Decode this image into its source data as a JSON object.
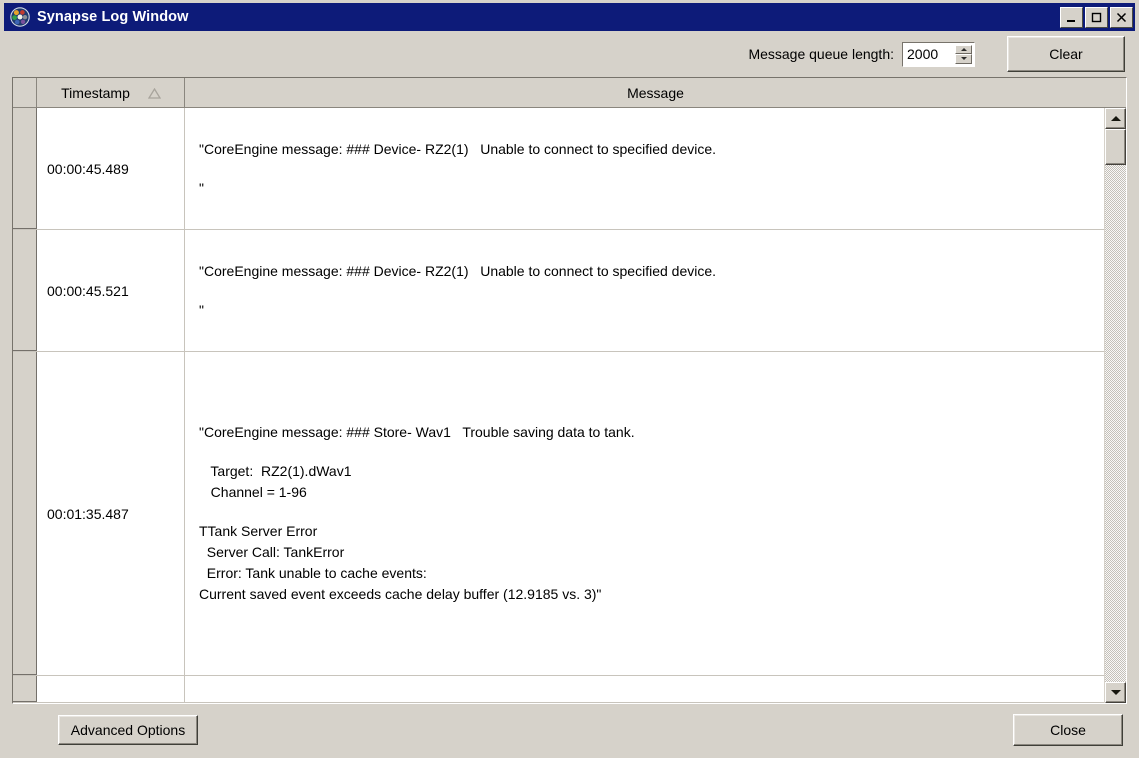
{
  "window": {
    "title": "Synapse Log Window",
    "icon": "synapse-logo-icon",
    "minimize_label": "Minimize",
    "maximize_label": "Maximize",
    "close_label": "Close"
  },
  "colors": {
    "titlebar": "#0d1b79",
    "chrome": "#d6d2ca",
    "grid_background": "#ffffff",
    "grid_line": "#c8c4bc",
    "text": "#000000"
  },
  "toolbar": {
    "queue_label": "Message queue length:",
    "queue_value": "2000",
    "queue_placeholder": "2000",
    "clear_label": "Clear"
  },
  "grid": {
    "columns": [
      {
        "key": "timestamp",
        "label": "Timestamp",
        "sort": "ascending",
        "sort_icon": "sort-ascending-triangle-icon"
      },
      {
        "key": "message",
        "label": "Message",
        "sort": "none"
      }
    ],
    "rows": [
      {
        "timestamp": "00:00:45.489",
        "lines": [
          "\"CoreEngine message: ### Device- RZ2(1)   Unable to connect to specified device.",
          "",
          "\""
        ]
      },
      {
        "timestamp": "00:00:45.521",
        "lines": [
          "\"CoreEngine message: ### Device- RZ2(1)   Unable to connect to specified device.",
          "",
          "\""
        ]
      },
      {
        "timestamp": "00:01:35.487",
        "lines": [
          "\"CoreEngine message: ### Store- Wav1   Trouble saving data to tank.",
          "",
          "   Target:  RZ2(1).dWav1",
          "   Channel = 1-96",
          "",
          "TTank Server Error",
          "  Server Call: TankError",
          "  Error: Tank unable to cache events:",
          "Current saved event exceeds cache delay buffer (12.9185 vs. 3)\""
        ]
      },
      {
        "timestamp": "",
        "lines": []
      }
    ]
  },
  "scrollbar": {
    "up_icon": "scroll-up-arrow-icon",
    "down_icon": "scroll-down-arrow-icon",
    "thumb": "scroll-thumb"
  },
  "footer": {
    "advanced_label": "Advanced Options",
    "close_label": "Close"
  }
}
